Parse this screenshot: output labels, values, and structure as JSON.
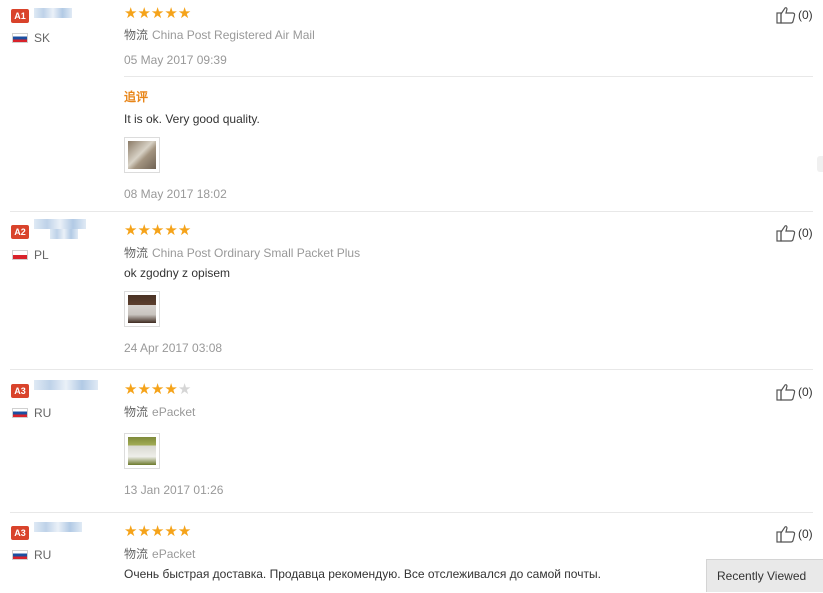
{
  "reviews": [
    {
      "badge": "A1",
      "country": "SK",
      "stars": 5,
      "shipping_label": "物流",
      "shipping_method": "China Post Registered Air Mail",
      "date": "05 May 2017 09:39",
      "followup": {
        "label": "追评",
        "text": "It is ok. Very good quality.",
        "date": "08 May 2017 18:02"
      },
      "likes": "(0)"
    },
    {
      "badge": "A2",
      "country": "PL",
      "stars": 5,
      "shipping_label": "物流",
      "shipping_method": "China Post Ordinary Small Packet Plus",
      "text": "ok zgodny z opisem",
      "date": "24 Apr 2017 03:08",
      "likes": "(0)"
    },
    {
      "badge": "A3",
      "country": "RU",
      "stars": 4,
      "shipping_label": "物流",
      "shipping_method": "ePacket",
      "date": "13 Jan 2017 01:26",
      "likes": "(0)"
    },
    {
      "badge": "A3",
      "country": "RU",
      "stars": 5,
      "shipping_label": "物流",
      "shipping_method": "ePacket",
      "text": "Очень быстрая доставка. Продавца рекомендую. Все отслеживался до самой почты.",
      "likes": "(0)"
    }
  ],
  "recently_viewed": "Recently Viewed",
  "colors": {
    "star": "#f5a31a",
    "badge": "#d9432b",
    "followup": "#e8861a"
  },
  "icons": {
    "like": "thumbs-up-icon",
    "star": "star-icon"
  }
}
